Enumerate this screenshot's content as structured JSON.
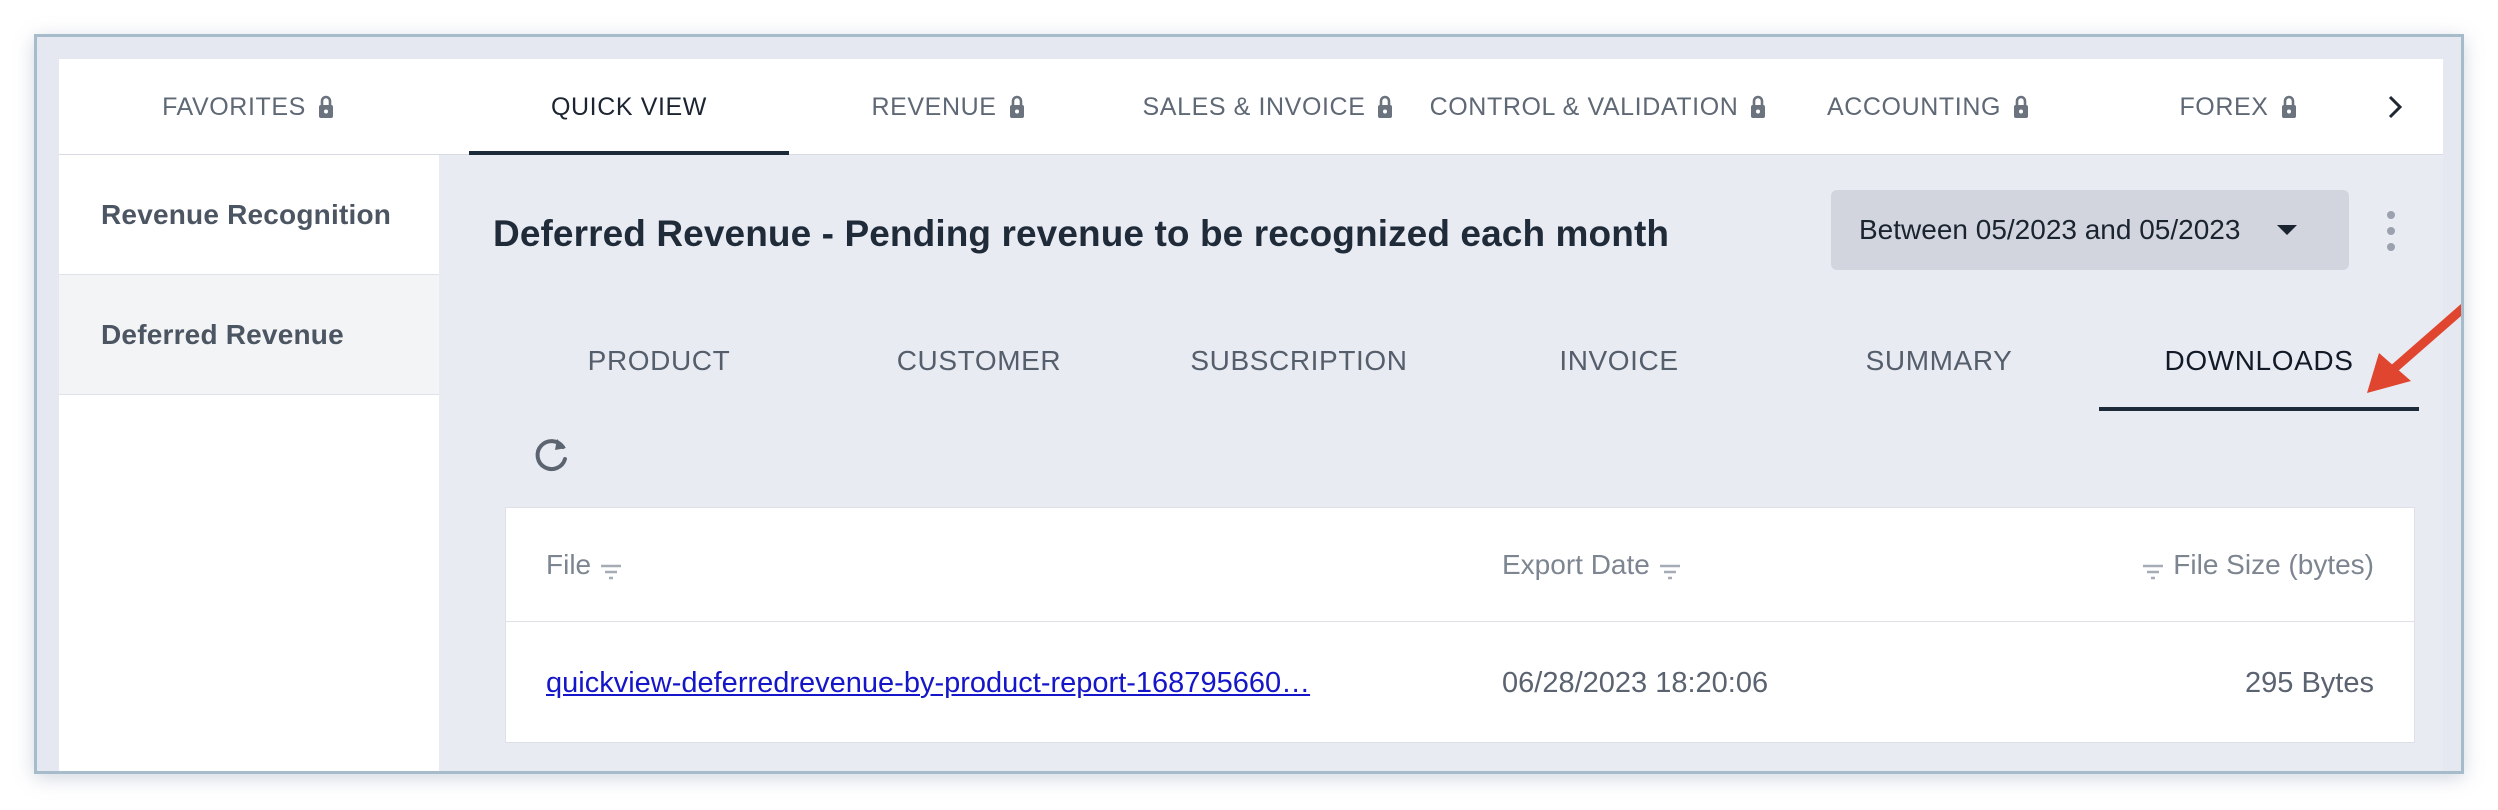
{
  "topnav": {
    "tabs": [
      {
        "label": "FAVORITES",
        "locked": true
      },
      {
        "label": "QUICK VIEW",
        "locked": false,
        "active": true
      },
      {
        "label": "REVENUE",
        "locked": true
      },
      {
        "label": "SALES & INVOICE",
        "locked": true
      },
      {
        "label": "CONTROL & VALIDATION",
        "locked": true
      },
      {
        "label": "ACCOUNTING",
        "locked": true
      },
      {
        "label": "FOREX",
        "locked": true
      }
    ],
    "next_icon": "chevron-right-icon"
  },
  "sidebar": {
    "items": [
      {
        "label": "Revenue Recognition"
      },
      {
        "label": "Deferred Revenue",
        "active": true
      }
    ]
  },
  "main": {
    "title": "Deferred Revenue - Pending revenue to be recognized each month",
    "date_filter": "Between 05/2023 and 05/2023",
    "subtabs": [
      {
        "label": "PRODUCT"
      },
      {
        "label": "CUSTOMER"
      },
      {
        "label": "SUBSCRIPTION"
      },
      {
        "label": "INVOICE"
      },
      {
        "label": "SUMMARY"
      },
      {
        "label": "DOWNLOADS",
        "active": true
      }
    ],
    "table": {
      "columns": [
        "File",
        "Export Date",
        "File Size (bytes)"
      ],
      "rows": [
        {
          "file": "quickview-deferredrevenue-by-product-report-168795660…",
          "export_date": "06/28/2023 18:20:06",
          "file_size": "295 Bytes"
        }
      ]
    }
  },
  "colors": {
    "accent": "#1d2a3a",
    "link": "#1515c9",
    "annotation_arrow": "#e0452f"
  }
}
